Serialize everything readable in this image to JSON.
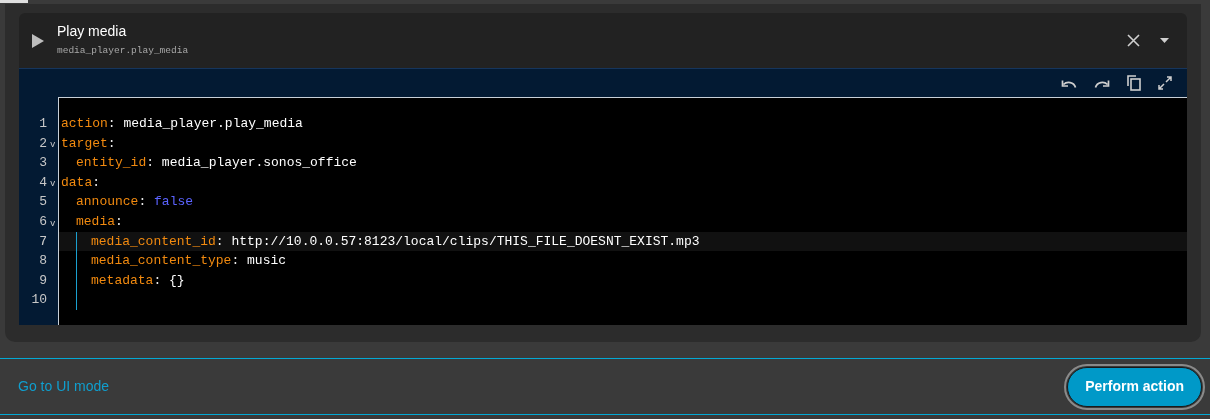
{
  "card": {
    "title": "Play media",
    "subtitle": "media_player.play_media"
  },
  "editor": {
    "lines": [
      {
        "number": "1",
        "active": false,
        "tokens": [
          {
            "text": "action",
            "kind": "key"
          },
          {
            "text": ":",
            "kind": "punct"
          },
          {
            "text": "media_player.play_media",
            "kind": "value"
          }
        ]
      },
      {
        "number": "2",
        "fold": "v",
        "active": false,
        "tokens": [
          {
            "text": "target",
            "kind": "key"
          },
          {
            "text": ":",
            "kind": "punct"
          }
        ],
        "children": [
          {
            "number": "3",
            "active": false,
            "tokens": [
              {
                "text": "entity_id",
                "kind": "key"
              },
              {
                "text": ":",
                "kind": "punct"
              },
              {
                "text": "media_player.sonos_office",
                "kind": "value"
              }
            ]
          }
        ]
      },
      {
        "number": "4",
        "fold": "v",
        "active": false,
        "tokens": [
          {
            "text": "data",
            "kind": "key"
          },
          {
            "text": ":",
            "kind": "punct"
          }
        ],
        "children": [
          {
            "number": "5",
            "active": false,
            "tokens": [
              {
                "text": "announce",
                "kind": "key"
              },
              {
                "text": ":",
                "kind": "punct"
              },
              {
                "text": "false",
                "kind": "bool"
              }
            ]
          },
          {
            "number": "6",
            "fold": "v",
            "active": false,
            "tokens": [
              {
                "text": "media",
                "kind": "key"
              },
              {
                "text": ":",
                "kind": "punct"
              }
            ],
            "children": [
              {
                "number": "7",
                "active": true,
                "tokens": [
                  {
                    "text": "media_content_id",
                    "kind": "key"
                  },
                  {
                    "text": ":",
                    "kind": "punct"
                  },
                  {
                    "text": "http://10.0.0.57:8123/local/clips/THIS_FILE_DOESNT_EXIST.mp3",
                    "kind": "value"
                  }
                ]
              },
              {
                "number": "8",
                "active": false,
                "tokens": [
                  {
                    "text": "media_content_type",
                    "kind": "key"
                  },
                  {
                    "text": ":",
                    "kind": "punct"
                  },
                  {
                    "text": "music",
                    "kind": "value"
                  }
                ]
              },
              {
                "number": "9",
                "active": false,
                "tokens": [
                  {
                    "text": "metadata",
                    "kind": "key"
                  },
                  {
                    "text": ":",
                    "kind": "punct"
                  },
                  {
                    "text": "{}",
                    "kind": "value"
                  }
                ]
              },
              {
                "number": "10",
                "active": false
              }
            ]
          }
        ]
      }
    ]
  },
  "footer": {
    "link": "Go to UI mode",
    "button": "Perform action"
  }
}
